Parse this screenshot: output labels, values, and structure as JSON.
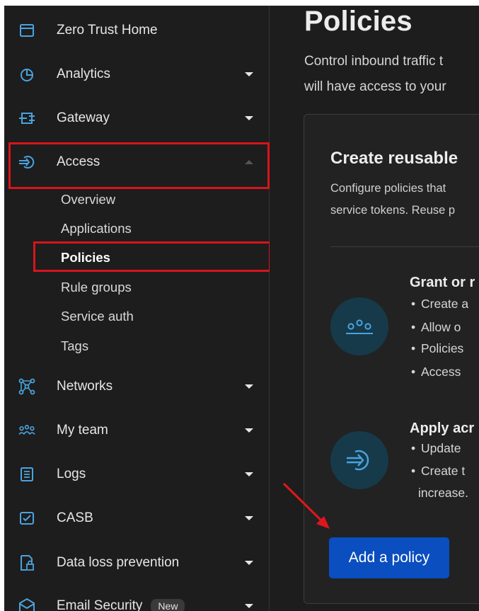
{
  "sidebar": {
    "items": [
      {
        "label": "Zero Trust Home",
        "icon": "browser-window-icon",
        "has_caret": false
      },
      {
        "label": "Analytics",
        "icon": "pie-chart-icon",
        "has_caret": true
      },
      {
        "label": "Gateway",
        "icon": "gateway-icon",
        "has_caret": true
      },
      {
        "label": "Access",
        "icon": "access-icon",
        "has_caret": true,
        "expanded": true
      },
      {
        "label": "Networks",
        "icon": "network-icon",
        "has_caret": true
      },
      {
        "label": "My team",
        "icon": "team-icon",
        "has_caret": true
      },
      {
        "label": "Logs",
        "icon": "logs-icon",
        "has_caret": true
      },
      {
        "label": "CASB",
        "icon": "casb-icon",
        "has_caret": true
      },
      {
        "label": "Data loss prevention",
        "icon": "dlp-icon",
        "has_caret": true
      },
      {
        "label": "Email Security",
        "icon": "email-security-icon",
        "has_caret": true,
        "badge": "New"
      }
    ],
    "access_subitems": [
      {
        "label": "Overview",
        "active": false
      },
      {
        "label": "Applications",
        "active": false
      },
      {
        "label": "Policies",
        "active": true
      },
      {
        "label": "Rule groups",
        "active": false
      },
      {
        "label": "Service auth",
        "active": false
      },
      {
        "label": "Tags",
        "active": false
      }
    ]
  },
  "main": {
    "title": "Policies",
    "description_lines": [
      "Control inbound traffic t",
      "will have access to your"
    ],
    "card": {
      "title": "Create reusable",
      "description_lines": [
        "Configure policies that",
        "service tokens. Reuse p"
      ],
      "feature1": {
        "title": "Grant or r",
        "bullets": [
          "Create a",
          "Allow o",
          "Policies",
          "Access"
        ]
      },
      "feature2": {
        "title": "Apply acr",
        "bullets": [
          "Update",
          "Create t"
        ],
        "continuation": "increase."
      },
      "button_label": "Add a policy"
    }
  },
  "colors": {
    "background": "#1d1d1d",
    "highlight_border": "#d7141c",
    "primary_button": "#0a4ec0",
    "icon_accent": "#4aa3df",
    "annotation_arrow": "#e0161c"
  }
}
